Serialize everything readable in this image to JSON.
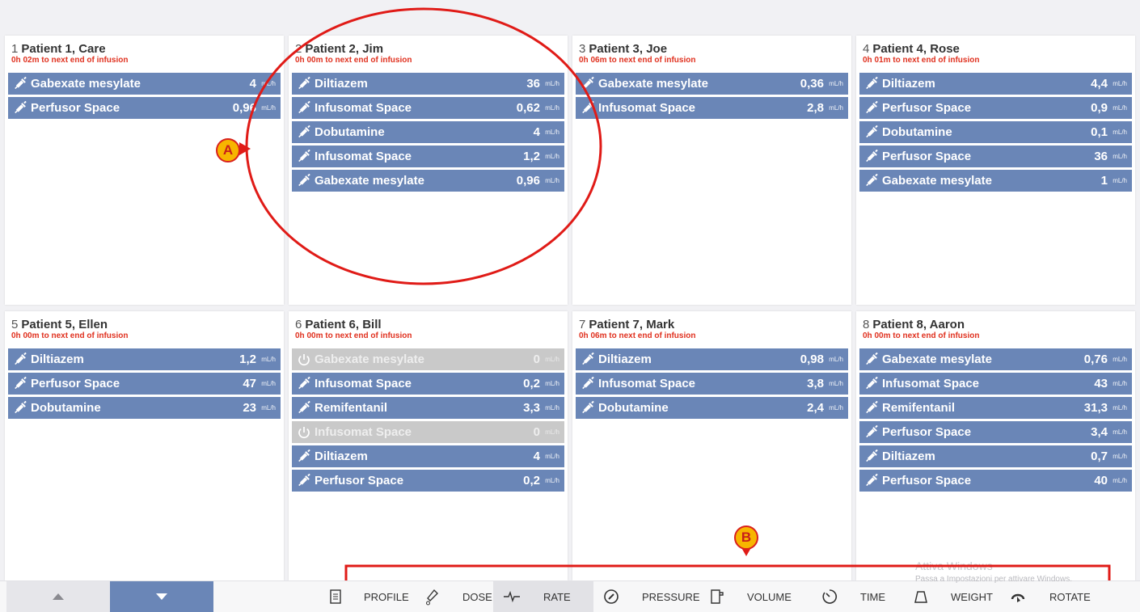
{
  "patients": [
    {
      "num": "1",
      "name": "Patient 1, Care",
      "sub": "0h 02m to next end of infusion",
      "rows": [
        {
          "drug": "Gabexate mesylate",
          "value": "4",
          "unit": "mL/h",
          "state": "on"
        },
        {
          "drug": "Perfusor Space",
          "value": "0,96",
          "unit": "mL/h",
          "state": "on"
        }
      ]
    },
    {
      "num": "2",
      "name": "Patient 2, Jim",
      "sub": "0h 00m to next end of infusion",
      "rows": [
        {
          "drug": "Diltiazem",
          "value": "36",
          "unit": "mL/h",
          "state": "on"
        },
        {
          "drug": "Infusomat Space",
          "value": "0,62",
          "unit": "mL/h",
          "state": "on"
        },
        {
          "drug": "Dobutamine",
          "value": "4",
          "unit": "mL/h",
          "state": "on"
        },
        {
          "drug": "Infusomat Space",
          "value": "1,2",
          "unit": "mL/h",
          "state": "on"
        },
        {
          "drug": "Gabexate mesylate",
          "value": "0,96",
          "unit": "mL/h",
          "state": "on"
        }
      ]
    },
    {
      "num": "3",
      "name": "Patient 3, Joe",
      "sub": "0h 06m to next end of infusion",
      "rows": [
        {
          "drug": "Gabexate mesylate",
          "value": "0,36",
          "unit": "mL/h",
          "state": "on"
        },
        {
          "drug": "Infusomat Space",
          "value": "2,8",
          "unit": "mL/h",
          "state": "on"
        }
      ]
    },
    {
      "num": "4",
      "name": "Patient 4, Rose",
      "sub": "0h 01m to next end of infusion",
      "rows": [
        {
          "drug": "Diltiazem",
          "value": "4,4",
          "unit": "mL/h",
          "state": "on"
        },
        {
          "drug": "Perfusor Space",
          "value": "0,9",
          "unit": "mL/h",
          "state": "on"
        },
        {
          "drug": "Dobutamine",
          "value": "0,1",
          "unit": "mL/h",
          "state": "on"
        },
        {
          "drug": "Perfusor Space",
          "value": "36",
          "unit": "mL/h",
          "state": "on"
        },
        {
          "drug": "Gabexate mesylate",
          "value": "1",
          "unit": "mL/h",
          "state": "on"
        }
      ]
    },
    {
      "num": "5",
      "name": "Patient 5, Ellen",
      "sub": "0h 00m to next end of infusion",
      "rows": [
        {
          "drug": "Diltiazem",
          "value": "1,2",
          "unit": "mL/h",
          "state": "on"
        },
        {
          "drug": "Perfusor Space",
          "value": "47",
          "unit": "mL/h",
          "state": "on"
        },
        {
          "drug": "Dobutamine",
          "value": "23",
          "unit": "mL/h",
          "state": "on"
        }
      ]
    },
    {
      "num": "6",
      "name": "Patient 6, Bill",
      "sub": "0h 00m to next end of infusion",
      "rows": [
        {
          "drug": "Gabexate mesylate",
          "value": "0",
          "unit": "mL/h",
          "state": "off"
        },
        {
          "drug": "Infusomat Space",
          "value": "0,2",
          "unit": "mL/h",
          "state": "on"
        },
        {
          "drug": "Remifentanil",
          "value": "3,3",
          "unit": "mL/h",
          "state": "on"
        },
        {
          "drug": "Infusomat Space",
          "value": "0",
          "unit": "mL/h",
          "state": "off"
        },
        {
          "drug": "Diltiazem",
          "value": "4",
          "unit": "mL/h",
          "state": "on"
        },
        {
          "drug": "Perfusor Space",
          "value": "0,2",
          "unit": "mL/h",
          "state": "on"
        }
      ]
    },
    {
      "num": "7",
      "name": "Patient 7, Mark",
      "sub": "0h 06m to next end of infusion",
      "rows": [
        {
          "drug": "Diltiazem",
          "value": "0,98",
          "unit": "mL/h",
          "state": "on"
        },
        {
          "drug": "Infusomat Space",
          "value": "3,8",
          "unit": "mL/h",
          "state": "on"
        },
        {
          "drug": "Dobutamine",
          "value": "2,4",
          "unit": "mL/h",
          "state": "on"
        }
      ]
    },
    {
      "num": "8",
      "name": "Patient 8, Aaron",
      "sub": "0h 00m to next end of infusion",
      "rows": [
        {
          "drug": "Gabexate mesylate",
          "value": "0,76",
          "unit": "mL/h",
          "state": "on"
        },
        {
          "drug": "Infusomat Space",
          "value": "43",
          "unit": "mL/h",
          "state": "on"
        },
        {
          "drug": "Remifentanil",
          "value": "31,3",
          "unit": "mL/h",
          "state": "on"
        },
        {
          "drug": "Perfusor Space",
          "value": "3,4",
          "unit": "mL/h",
          "state": "on"
        },
        {
          "drug": "Diltiazem",
          "value": "0,7",
          "unit": "mL/h",
          "state": "on"
        },
        {
          "drug": "Perfusor Space",
          "value": "40",
          "unit": "mL/h",
          "state": "on"
        }
      ]
    }
  ],
  "toolbar": {
    "tools": [
      {
        "label": "PROFILE",
        "icon": "profile-icon",
        "active": false
      },
      {
        "label": "DOSE",
        "icon": "dose-icon",
        "active": false
      },
      {
        "label": "RATE",
        "icon": "rate-icon",
        "active": true
      },
      {
        "label": "PRESSURE",
        "icon": "pressure-icon",
        "active": false
      },
      {
        "label": "VOLUME",
        "icon": "volume-icon",
        "active": false
      },
      {
        "label": "TIME",
        "icon": "time-icon",
        "active": false
      },
      {
        "label": "WEIGHT",
        "icon": "weight-icon",
        "active": false
      },
      {
        "label": "ROTATE",
        "icon": "rotate-icon",
        "active": false
      }
    ]
  },
  "annotations": {
    "a": "A",
    "b": "B"
  },
  "watermark": {
    "line1": "Attiva Windows",
    "line2": "Passa a Impostazioni per attivare Windows."
  },
  "colors": {
    "row": "#6a86b7",
    "row_off": "#c9c9c9",
    "alert_text": "#e0311f",
    "annotation": "#e01b17",
    "badge": "#f7b500"
  }
}
